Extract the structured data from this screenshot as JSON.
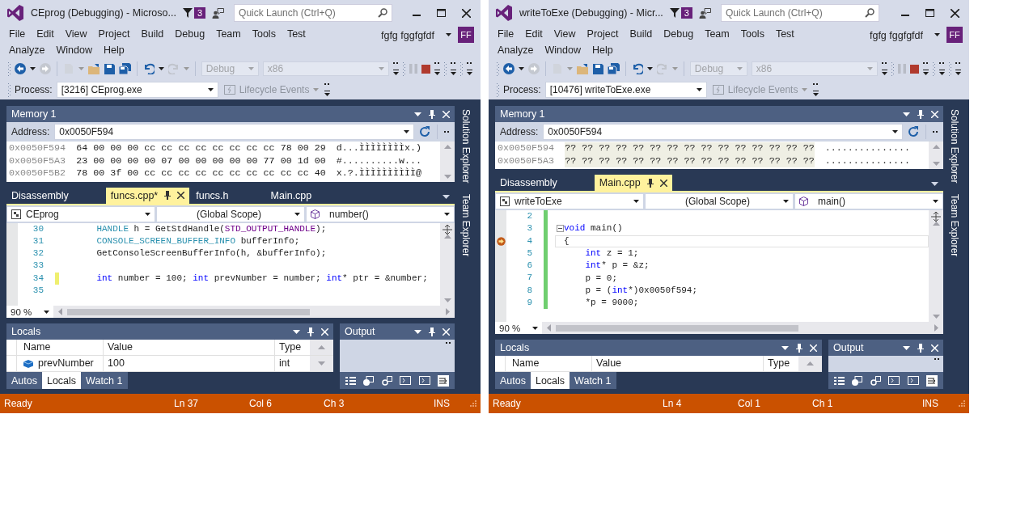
{
  "windows": [
    {
      "title": "CEprog (Debugging) - Microso...",
      "notification_count": "3",
      "quick_launch": {
        "placeholder": "Quick Launch (Ctrl+Q)"
      },
      "menu": [
        "File",
        "Edit",
        "View",
        "Project",
        "Build",
        "Debug",
        "Team",
        "Tools",
        "Test",
        "Analyze",
        "Window",
        "Help"
      ],
      "user": "fgfg fggfgfdf",
      "avatar": "FF",
      "toolbar": {
        "configuration": "Debug",
        "platform": "x86"
      },
      "process": {
        "label": "Process:",
        "value": "[3216] CEprog.exe"
      },
      "lifecycle": "Lifecycle Events",
      "memory": {
        "title": "Memory 1",
        "address_label": "Address:",
        "address": "0x0050F594",
        "rows": [
          {
            "address": "0x0050F594",
            "bytes": "64 00 00 00 cc cc cc cc cc cc cc cc 78 00 29",
            "text": "d...ÌÌÌÌÌÌÌÌx.)",
            "unreadable": false
          },
          {
            "address": "0x0050F5A3",
            "bytes": "23 00 00 00 00 07 00 00 00 00 00 77 00 1d 00",
            "text": "#..........w...",
            "unreadable": false
          },
          {
            "address": "0x0050F5B2",
            "bytes": "78 00 3f 00 cc cc cc cc cc cc cc cc cc cc 40",
            "text": "x.?.ÌÌÌÌÌÌÌÌÌÌ@",
            "unreadable": false
          }
        ]
      },
      "side_tabs": [
        "Solution Explorer",
        "Team Explorer"
      ],
      "editor": {
        "tabs": [
          {
            "label": "Disassembly",
            "selected": false
          },
          {
            "label": "funcs.cpp*",
            "selected": true
          },
          {
            "label": "funcs.h",
            "selected": false
          },
          {
            "label": "Main.cpp",
            "selected": false
          }
        ],
        "project": "CEprog",
        "scope": "(Global Scope)",
        "member": "number()",
        "zoom": "90 %",
        "lines": [
          {
            "number": "30",
            "current": false,
            "foldable": false,
            "unsaved_change": false,
            "saved_change": false,
            "tokens": [
              {
                "kind": "type",
                "text": "    HANDLE"
              },
              {
                "kind": "plain",
                "text": " h = GetStdHandle("
              },
              {
                "kind": "macro",
                "text": "STD_OUTPUT_HANDLE"
              },
              {
                "kind": "plain",
                "text": ");"
              }
            ]
          },
          {
            "number": "31",
            "current": false,
            "foldable": false,
            "unsaved_change": false,
            "saved_change": false,
            "tokens": [
              {
                "kind": "type",
                "text": "    CONSOLE_SCREEN_BUFFER_INFO"
              },
              {
                "kind": "plain",
                "text": " bufferInfo;"
              }
            ]
          },
          {
            "number": "32",
            "current": false,
            "foldable": false,
            "unsaved_change": false,
            "saved_change": false,
            "tokens": [
              {
                "kind": "plain",
                "text": "    GetConsoleScreenBufferInfo(h, &bufferInfo);"
              }
            ]
          },
          {
            "number": "33",
            "current": false,
            "foldable": false,
            "unsaved_change": false,
            "saved_change": false
          },
          {
            "number": "34",
            "current": false,
            "foldable": false,
            "unsaved_change": true,
            "saved_change": false,
            "tokens": [
              {
                "kind": "keyword",
                "text": "    int"
              },
              {
                "kind": "plain",
                "text": " number = 100; "
              },
              {
                "kind": "keyword",
                "text": "int"
              },
              {
                "kind": "plain",
                "text": " prevNumber = number; "
              },
              {
                "kind": "keyword",
                "text": "int"
              },
              {
                "kind": "plain",
                "text": "* ptr = &number;"
              }
            ]
          },
          {
            "number": "35",
            "current": false,
            "foldable": false,
            "unsaved_change": false,
            "saved_change": false
          }
        ]
      },
      "locals": {
        "title": "Locals",
        "columns": [
          "Name",
          "Value",
          "Type"
        ],
        "rows": [
          {
            "name": "prevNumber",
            "value": "100",
            "type": "int"
          }
        ],
        "tabs": [
          {
            "label": "Autos",
            "selected": false
          },
          {
            "label": "Locals",
            "selected": true
          },
          {
            "label": "Watch 1",
            "selected": false
          }
        ]
      },
      "output": {
        "title": "Output"
      },
      "status": {
        "text": "Ready",
        "line": "Ln 37",
        "column": "Col 6",
        "char": "Ch 3",
        "mode": "INS"
      }
    },
    {
      "title": "writeToExe (Debugging) - Micr...",
      "notification_count": "3",
      "quick_launch": {
        "placeholder": "Quick Launch (Ctrl+Q)"
      },
      "menu": [
        "File",
        "Edit",
        "View",
        "Project",
        "Build",
        "Debug",
        "Team",
        "Tools",
        "Test",
        "Analyze",
        "Window",
        "Help"
      ],
      "user": "fgfg fggfgfdf",
      "avatar": "FF",
      "toolbar": {
        "configuration": "Debug",
        "platform": "x86"
      },
      "process": {
        "label": "Process:",
        "value": "[10476] writeToExe.exe"
      },
      "lifecycle": "Lifecycle Events",
      "memory": {
        "title": "Memory 1",
        "address_label": "Address:",
        "address": "0x0050F594",
        "rows": [
          {
            "address": "0x0050F594",
            "bytes": "?? ?? ?? ?? ?? ?? ?? ?? ?? ?? ?? ?? ?? ?? ??",
            "text": "...............",
            "unreadable": true
          },
          {
            "address": "0x0050F5A3",
            "bytes": "?? ?? ?? ?? ?? ?? ?? ?? ?? ?? ?? ?? ?? ?? ??",
            "text": "...............",
            "unreadable": true
          }
        ]
      },
      "side_tabs": [
        "Solution Explorer",
        "Team Explorer"
      ],
      "editor": {
        "tabs": [
          {
            "label": "Disassembly",
            "selected": false
          },
          {
            "label": "Main.cpp",
            "selected": true
          }
        ],
        "project": "writeToExe",
        "scope": "(Global Scope)",
        "member": "main()",
        "zoom": "90 %",
        "lines": [
          {
            "number": "2",
            "current": false,
            "foldable": false,
            "unsaved_change": false,
            "saved_change": true
          },
          {
            "number": "3",
            "current": false,
            "foldable": true,
            "unsaved_change": false,
            "saved_change": true,
            "tokens": [
              {
                "kind": "keyword",
                "text": "void"
              },
              {
                "kind": "plain",
                "text": " main()"
              }
            ]
          },
          {
            "number": "4",
            "current": true,
            "foldable": false,
            "unsaved_change": false,
            "saved_change": true,
            "tokens": [
              {
                "kind": "plain",
                "text": "{"
              }
            ]
          },
          {
            "number": "5",
            "current": false,
            "foldable": false,
            "unsaved_change": false,
            "saved_change": true,
            "tokens": [
              {
                "kind": "keyword",
                "text": "    int"
              },
              {
                "kind": "plain",
                "text": " z = 1;"
              }
            ]
          },
          {
            "number": "6",
            "current": false,
            "foldable": false,
            "unsaved_change": false,
            "saved_change": true,
            "tokens": [
              {
                "kind": "keyword",
                "text": "    int"
              },
              {
                "kind": "plain",
                "text": "* p = &z;"
              }
            ]
          },
          {
            "number": "7",
            "current": false,
            "foldable": false,
            "unsaved_change": false,
            "saved_change": true,
            "tokens": [
              {
                "kind": "plain",
                "text": "    p = 0;"
              }
            ]
          },
          {
            "number": "8",
            "current": false,
            "foldable": false,
            "unsaved_change": false,
            "saved_change": true,
            "tokens": [
              {
                "kind": "plain",
                "text": "    p = ("
              },
              {
                "kind": "keyword",
                "text": "int"
              },
              {
                "kind": "plain",
                "text": "*)0x0050f594;"
              }
            ]
          },
          {
            "number": "9",
            "current": false,
            "foldable": false,
            "unsaved_change": false,
            "saved_change": true,
            "tokens": [
              {
                "kind": "plain",
                "text": "    *p = 9000;"
              }
            ]
          }
        ]
      },
      "locals": {
        "title": "Locals",
        "columns": [
          "Name",
          "Value",
          "Type"
        ],
        "tabs": [
          {
            "label": "Autos",
            "selected": false
          },
          {
            "label": "Locals",
            "selected": true
          },
          {
            "label": "Watch 1",
            "selected": false
          }
        ]
      },
      "output": {
        "title": "Output"
      },
      "status": {
        "text": "Ready",
        "line": "Ln 4",
        "column": "Col 1",
        "char": "Ch 1",
        "mode": "INS"
      }
    }
  ]
}
